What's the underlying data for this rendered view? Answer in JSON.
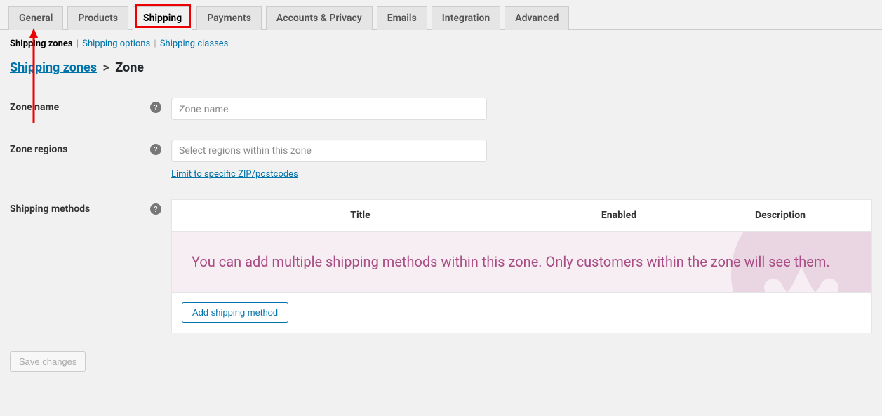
{
  "tabs": {
    "general": "General",
    "products": "Products",
    "shipping": "Shipping",
    "payments": "Payments",
    "accounts": "Accounts & Privacy",
    "emails": "Emails",
    "integration": "Integration",
    "advanced": "Advanced"
  },
  "subnav": {
    "zones": "Shipping zones",
    "options": "Shipping options",
    "classes": "Shipping classes"
  },
  "breadcrumb": {
    "zones": "Shipping zones",
    "sep": ">",
    "current": "Zone"
  },
  "labels": {
    "zone_name": "Zone name",
    "zone_regions": "Zone regions",
    "shipping_methods": "Shipping methods"
  },
  "placeholders": {
    "zone_name": "Zone name",
    "zone_regions": "Select regions within this zone"
  },
  "links": {
    "limit_zip": "Limit to specific ZIP/postcodes"
  },
  "methods_table": {
    "col_title": "Title",
    "col_enabled": "Enabled",
    "col_description": "Description",
    "blank_slate": "You can add multiple shipping methods within this zone. Only customers within the zone will see them.",
    "add_button": "Add shipping method"
  },
  "buttons": {
    "save": "Save changes"
  },
  "help_glyph": "?"
}
